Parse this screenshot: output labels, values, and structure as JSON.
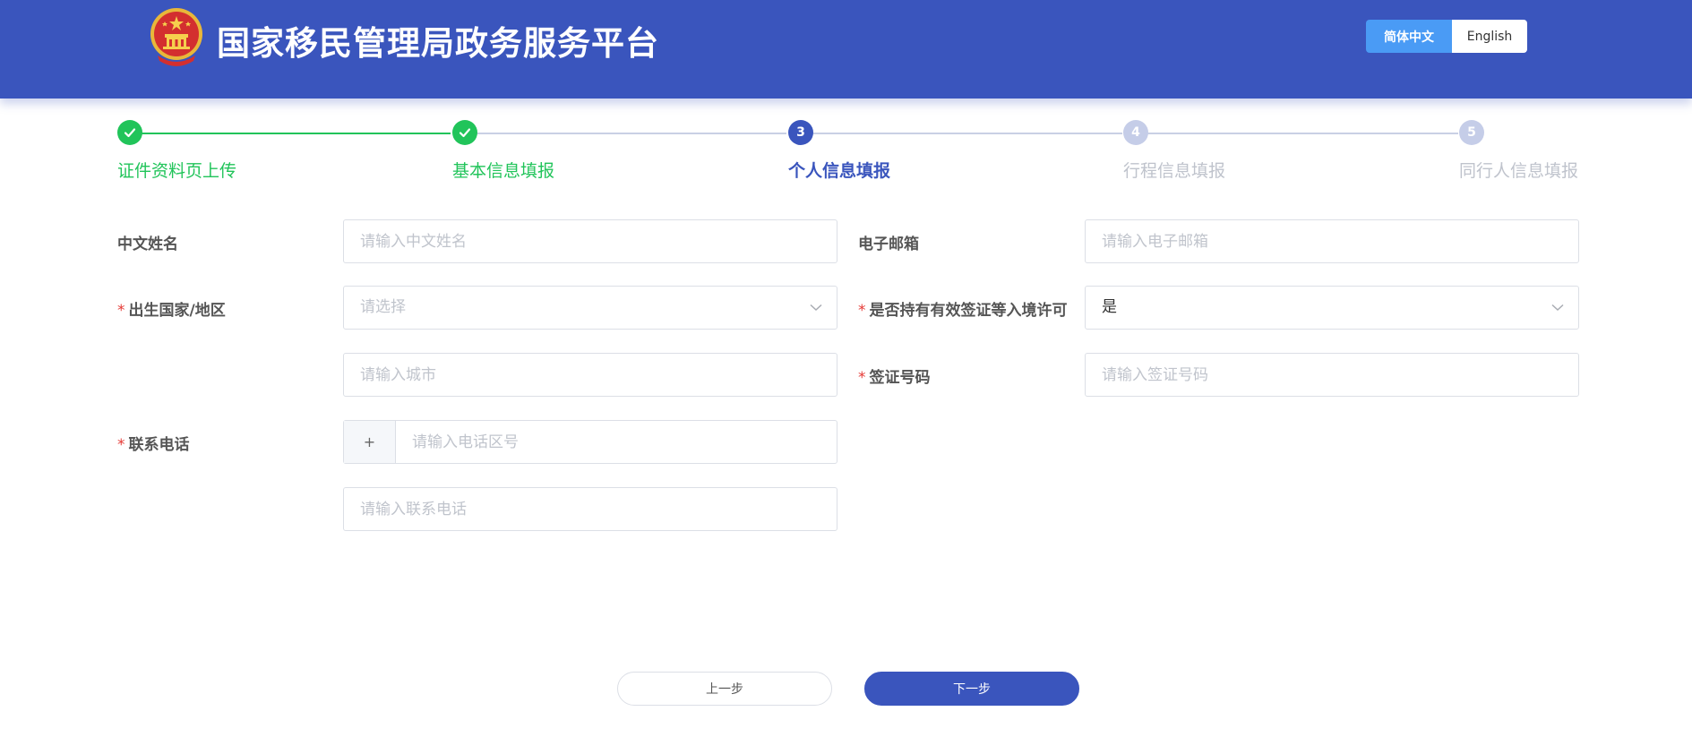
{
  "header": {
    "title": "国家移民管理局政务服务平台",
    "lang_zh": "简体中文",
    "lang_en": "English",
    "active_lang": "zh"
  },
  "steps": [
    {
      "number": "1",
      "label": "证件资料页上传",
      "status": "done"
    },
    {
      "number": "2",
      "label": "基本信息填报",
      "status": "done"
    },
    {
      "number": "3",
      "label": "个人信息填报",
      "status": "active"
    },
    {
      "number": "4",
      "label": "行程信息填报",
      "status": "todo"
    },
    {
      "number": "5",
      "label": "同行人信息填报",
      "status": "todo"
    }
  ],
  "form": {
    "chinese_name": {
      "label": "中文姓名",
      "required": false,
      "placeholder": "请输入中文姓名",
      "value": ""
    },
    "email": {
      "label": "电子邮箱",
      "required": false,
      "placeholder": "请输入电子邮箱",
      "value": ""
    },
    "birth_country": {
      "label": "出生国家/地区",
      "required": true,
      "placeholder": "请选择",
      "value": ""
    },
    "valid_visa": {
      "label": "是否持有有效签证等入境许可",
      "required": true,
      "value": "是"
    },
    "birth_city": {
      "placeholder": "请输入城市",
      "value": ""
    },
    "visa_number": {
      "label": "签证号码",
      "required": true,
      "placeholder": "请输入签证号码",
      "value": ""
    },
    "phone": {
      "label": "联系电话",
      "required": true,
      "prefix": "+",
      "area_placeholder": "请输入电话区号",
      "number_placeholder": "请输入联系电话"
    }
  },
  "buttons": {
    "prev": "上一步",
    "next": "下一步"
  },
  "colors": {
    "header": "#3a55bd",
    "done": "#21c45a",
    "active": "#3a55bd",
    "todo": "#c5cde8",
    "required": "#e53935",
    "lang_active": "#4a9bf5"
  },
  "icons": {
    "emblem": "national-emblem-icon",
    "check": "check-icon",
    "select": "chevron-down-icon"
  }
}
